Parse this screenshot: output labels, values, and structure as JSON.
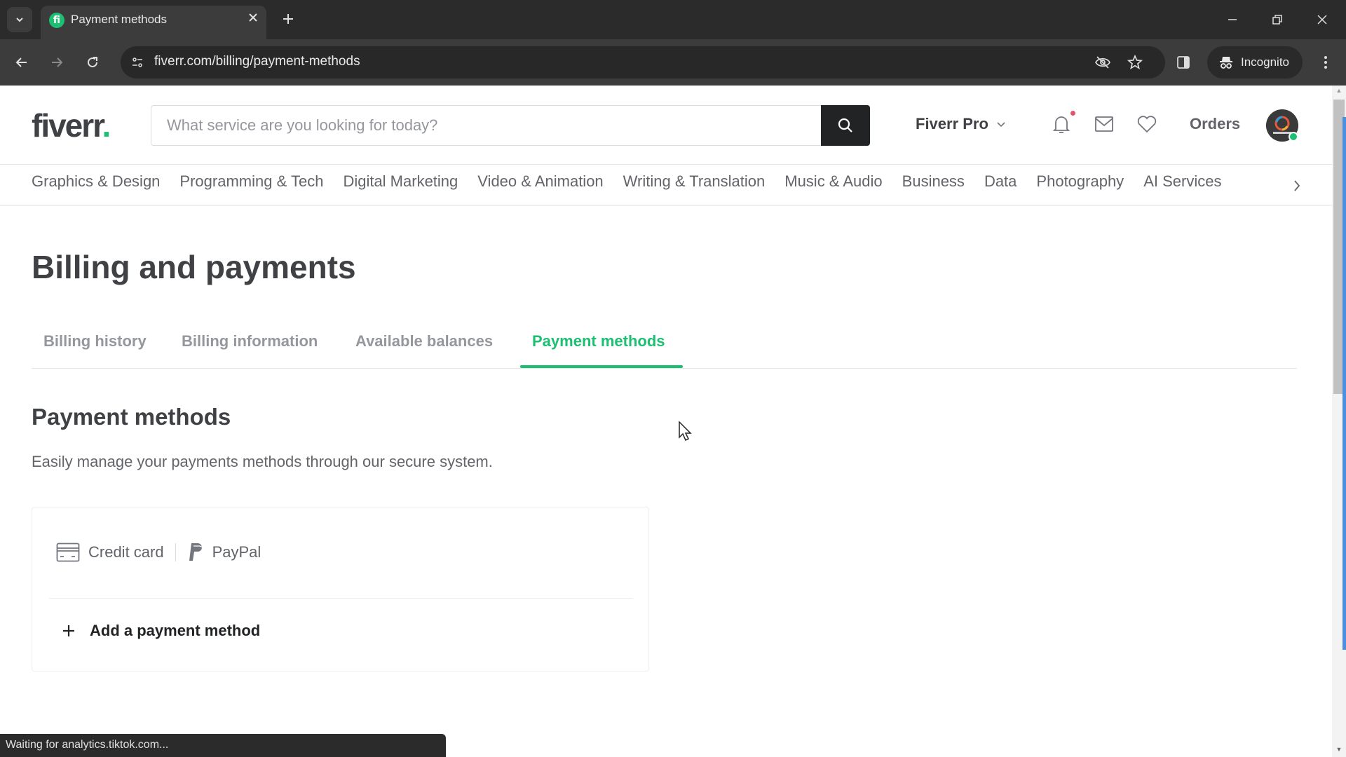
{
  "browser": {
    "tab": {
      "title": "Payment methods",
      "favicon": "fiverr-favicon",
      "favicon_letter": "fi"
    },
    "new_tab_icon": "+",
    "url": "fiverr.com/billing/payment-methods",
    "incognito_label": "Incognito",
    "status_text": "Waiting for analytics.tiktok.com..."
  },
  "header": {
    "logo_text": "fiverr",
    "logo_dot": ".",
    "search_placeholder": "What service are you looking for today?",
    "search_value": "",
    "pro_label": "Fiverr Pro",
    "orders_label": "Orders",
    "has_notification": true
  },
  "categories": [
    "Graphics & Design",
    "Programming & Tech",
    "Digital Marketing",
    "Video & Animation",
    "Writing & Translation",
    "Music & Audio",
    "Business",
    "Data",
    "Photography",
    "AI Services"
  ],
  "page": {
    "title": "Billing and payments",
    "tabs": [
      {
        "label": "Billing history",
        "active": false
      },
      {
        "label": "Billing information",
        "active": false
      },
      {
        "label": "Available balances",
        "active": false
      },
      {
        "label": "Payment methods",
        "active": true
      }
    ],
    "section_title": "Payment methods",
    "section_description": "Easily manage your payments methods through our secure system.",
    "methods": [
      {
        "label": "Credit card",
        "icon": "credit-card-icon"
      },
      {
        "label": "PayPal",
        "icon": "paypal-icon"
      }
    ],
    "add_method_label": "Add a payment method"
  },
  "colors": {
    "brand_green": "#1dbf73",
    "text_dark": "#404145",
    "text_muted": "#62646a",
    "notification_dot": "#e0566c"
  }
}
